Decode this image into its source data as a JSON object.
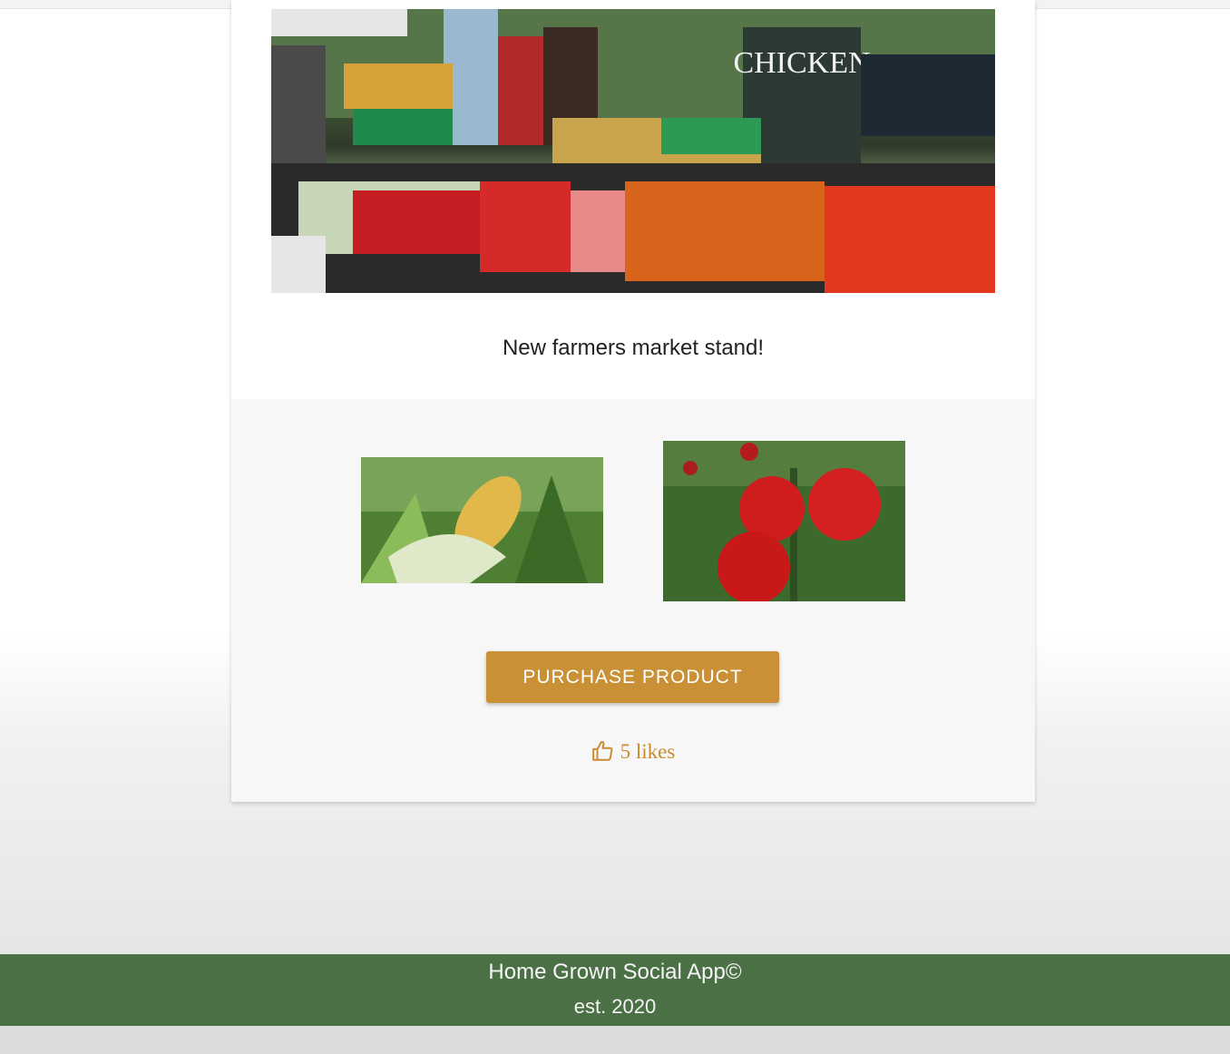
{
  "post": {
    "hero_image": "farmers-market-stand-photo",
    "hero_sign_text": "CHICKEN",
    "caption": "New farmers market stand!",
    "products": [
      {
        "image": "corn-photo"
      },
      {
        "image": "tomato-photo"
      }
    ],
    "purchase_label": "PURCHASE PRODUCT",
    "like_icon": "thumbs-up-icon",
    "likes_text": "5 likes"
  },
  "footer": {
    "app_name": "Home Grown Social App©",
    "established": "est. 2020"
  },
  "colors": {
    "accent": "#c99035",
    "footer_bg": "#4b7045"
  }
}
